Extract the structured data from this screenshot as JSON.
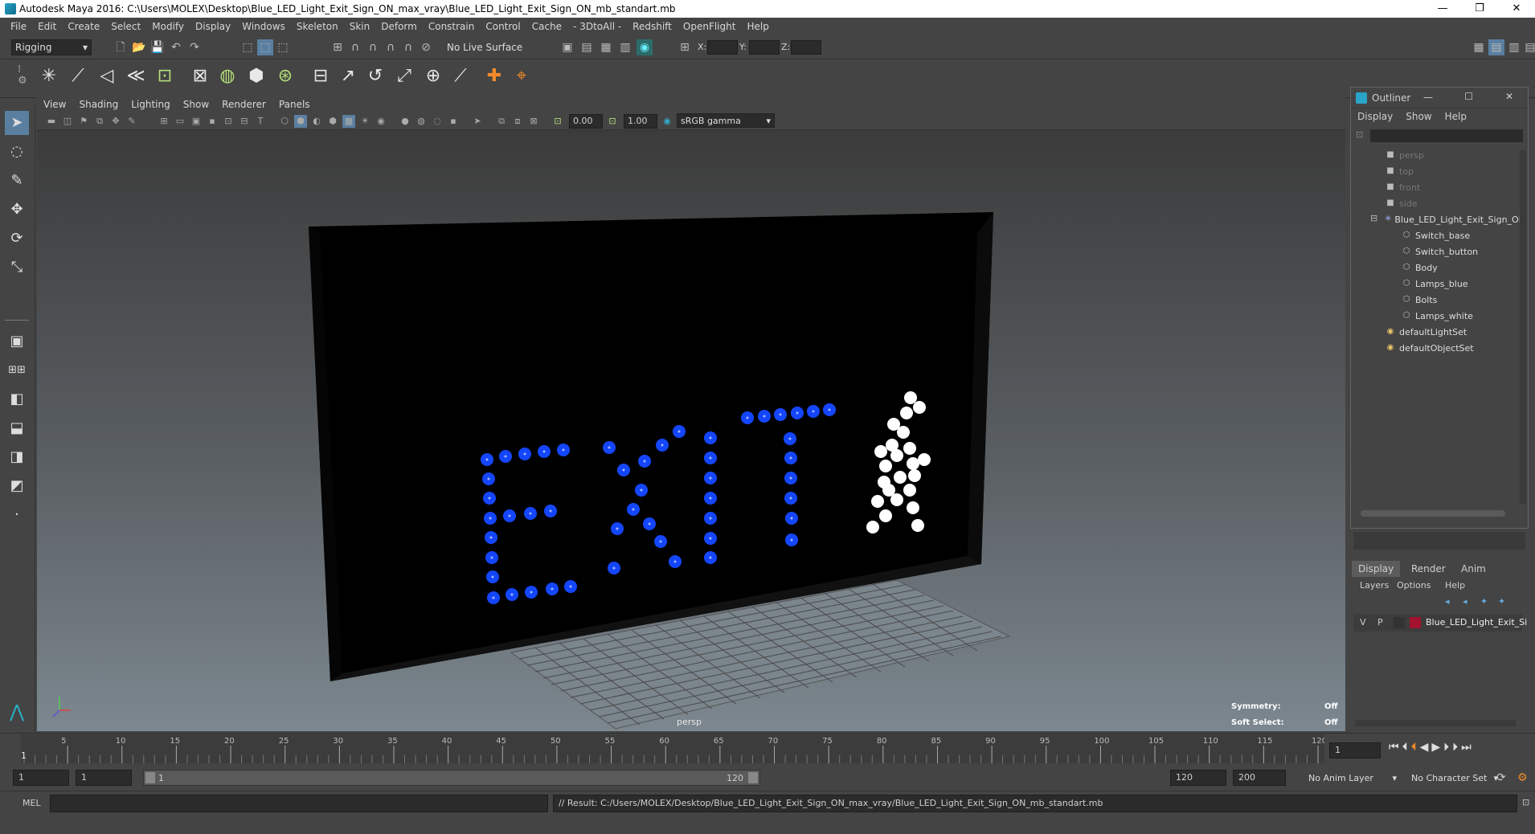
{
  "window": {
    "title": "Autodesk Maya 2016: C:\\Users\\MOLEX\\Desktop\\Blue_LED_Light_Exit_Sign_ON_max_vray\\Blue_LED_Light_Exit_Sign_ON_mb_standart.mb",
    "controls": [
      "—",
      "❐",
      "✕"
    ]
  },
  "menubar": [
    "File",
    "Edit",
    "Create",
    "Select",
    "Modify",
    "Display",
    "Windows",
    "Skeleton",
    "Skin",
    "Deform",
    "Constrain",
    "Control",
    "Cache",
    "- 3DtoAll -",
    "Redshift",
    "OpenFlight",
    "Help"
  ],
  "statusline": {
    "mode": "Rigging",
    "live_surface": "No Live Surface",
    "x_label": "X:",
    "y_label": "Y:",
    "z_label": "Z:"
  },
  "panel": {
    "menus": [
      "View",
      "Shading",
      "Lighting",
      "Show",
      "Renderer",
      "Panels"
    ],
    "exposure": "0.00",
    "gamma": "1.00",
    "colorspace": "sRGB gamma",
    "camera_label": "persp",
    "symmetry_label": "Symmetry:",
    "symmetry_value": "Off",
    "softselect_label": "Soft Select:",
    "softselect_value": "Off"
  },
  "scene": {
    "sign_text": "EXIT",
    "led_color": "#1446ff",
    "figure_color": "#ffffff",
    "body_color": "#000000"
  },
  "outliner": {
    "title": "Outliner",
    "menus": [
      "Display",
      "Show",
      "Help"
    ],
    "items": [
      {
        "label": "persp",
        "dim": true,
        "indent": 0,
        "icon": "camera-icon"
      },
      {
        "label": "top",
        "dim": true,
        "indent": 0,
        "icon": "camera-icon"
      },
      {
        "label": "front",
        "dim": true,
        "indent": 0,
        "icon": "camera-icon"
      },
      {
        "label": "side",
        "dim": true,
        "indent": 0,
        "icon": "camera-icon"
      },
      {
        "label": "Blue_LED_Light_Exit_Sign_ON",
        "dim": false,
        "indent": 0,
        "icon": "group-icon"
      },
      {
        "label": "Switch_base",
        "dim": false,
        "indent": 1,
        "icon": "mesh-icon"
      },
      {
        "label": "Switch_button",
        "dim": false,
        "indent": 1,
        "icon": "mesh-icon"
      },
      {
        "label": "Body",
        "dim": false,
        "indent": 1,
        "icon": "mesh-icon"
      },
      {
        "label": "Lamps_blue",
        "dim": false,
        "indent": 1,
        "icon": "mesh-icon"
      },
      {
        "label": "Bolts",
        "dim": false,
        "indent": 1,
        "icon": "mesh-icon"
      },
      {
        "label": "Lamps_white",
        "dim": false,
        "indent": 1,
        "icon": "mesh-icon"
      },
      {
        "label": "defaultLightSet",
        "dim": false,
        "indent": 0,
        "icon": "set-icon"
      },
      {
        "label": "defaultObjectSet",
        "dim": false,
        "indent": 0,
        "icon": "set-icon"
      }
    ]
  },
  "layers": {
    "tabs": [
      "Display",
      "Render",
      "Anim"
    ],
    "menus": [
      "Layers",
      "Options",
      "Help"
    ],
    "layer_v": "V",
    "layer_p": "P",
    "layer_name": "Blue_LED_Light_Exit_Si",
    "layer_color": "#a3122e"
  },
  "timeline": {
    "ticks": [
      "5",
      "10",
      "15",
      "20",
      "25",
      "30",
      "35",
      "40",
      "45",
      "50",
      "55",
      "60",
      "65",
      "70",
      "75",
      "80",
      "85",
      "90",
      "95",
      "100",
      "105",
      "110",
      "115",
      "120"
    ],
    "start_marker": "1",
    "current_frame": "1"
  },
  "range": {
    "start": "1",
    "playback_start": "1",
    "slider_left": "1",
    "slider_right": "120",
    "playback_end": "120",
    "end": "200",
    "anim_layer": "No Anim Layer",
    "character_set": "No Character Set"
  },
  "cmdline": {
    "lang": "MEL",
    "result": "// Result: C:/Users/MOLEX/Desktop/Blue_LED_Light_Exit_Sign_ON_max_vray/Blue_LED_Light_Exit_Sign_ON_mb_standart.mb"
  }
}
